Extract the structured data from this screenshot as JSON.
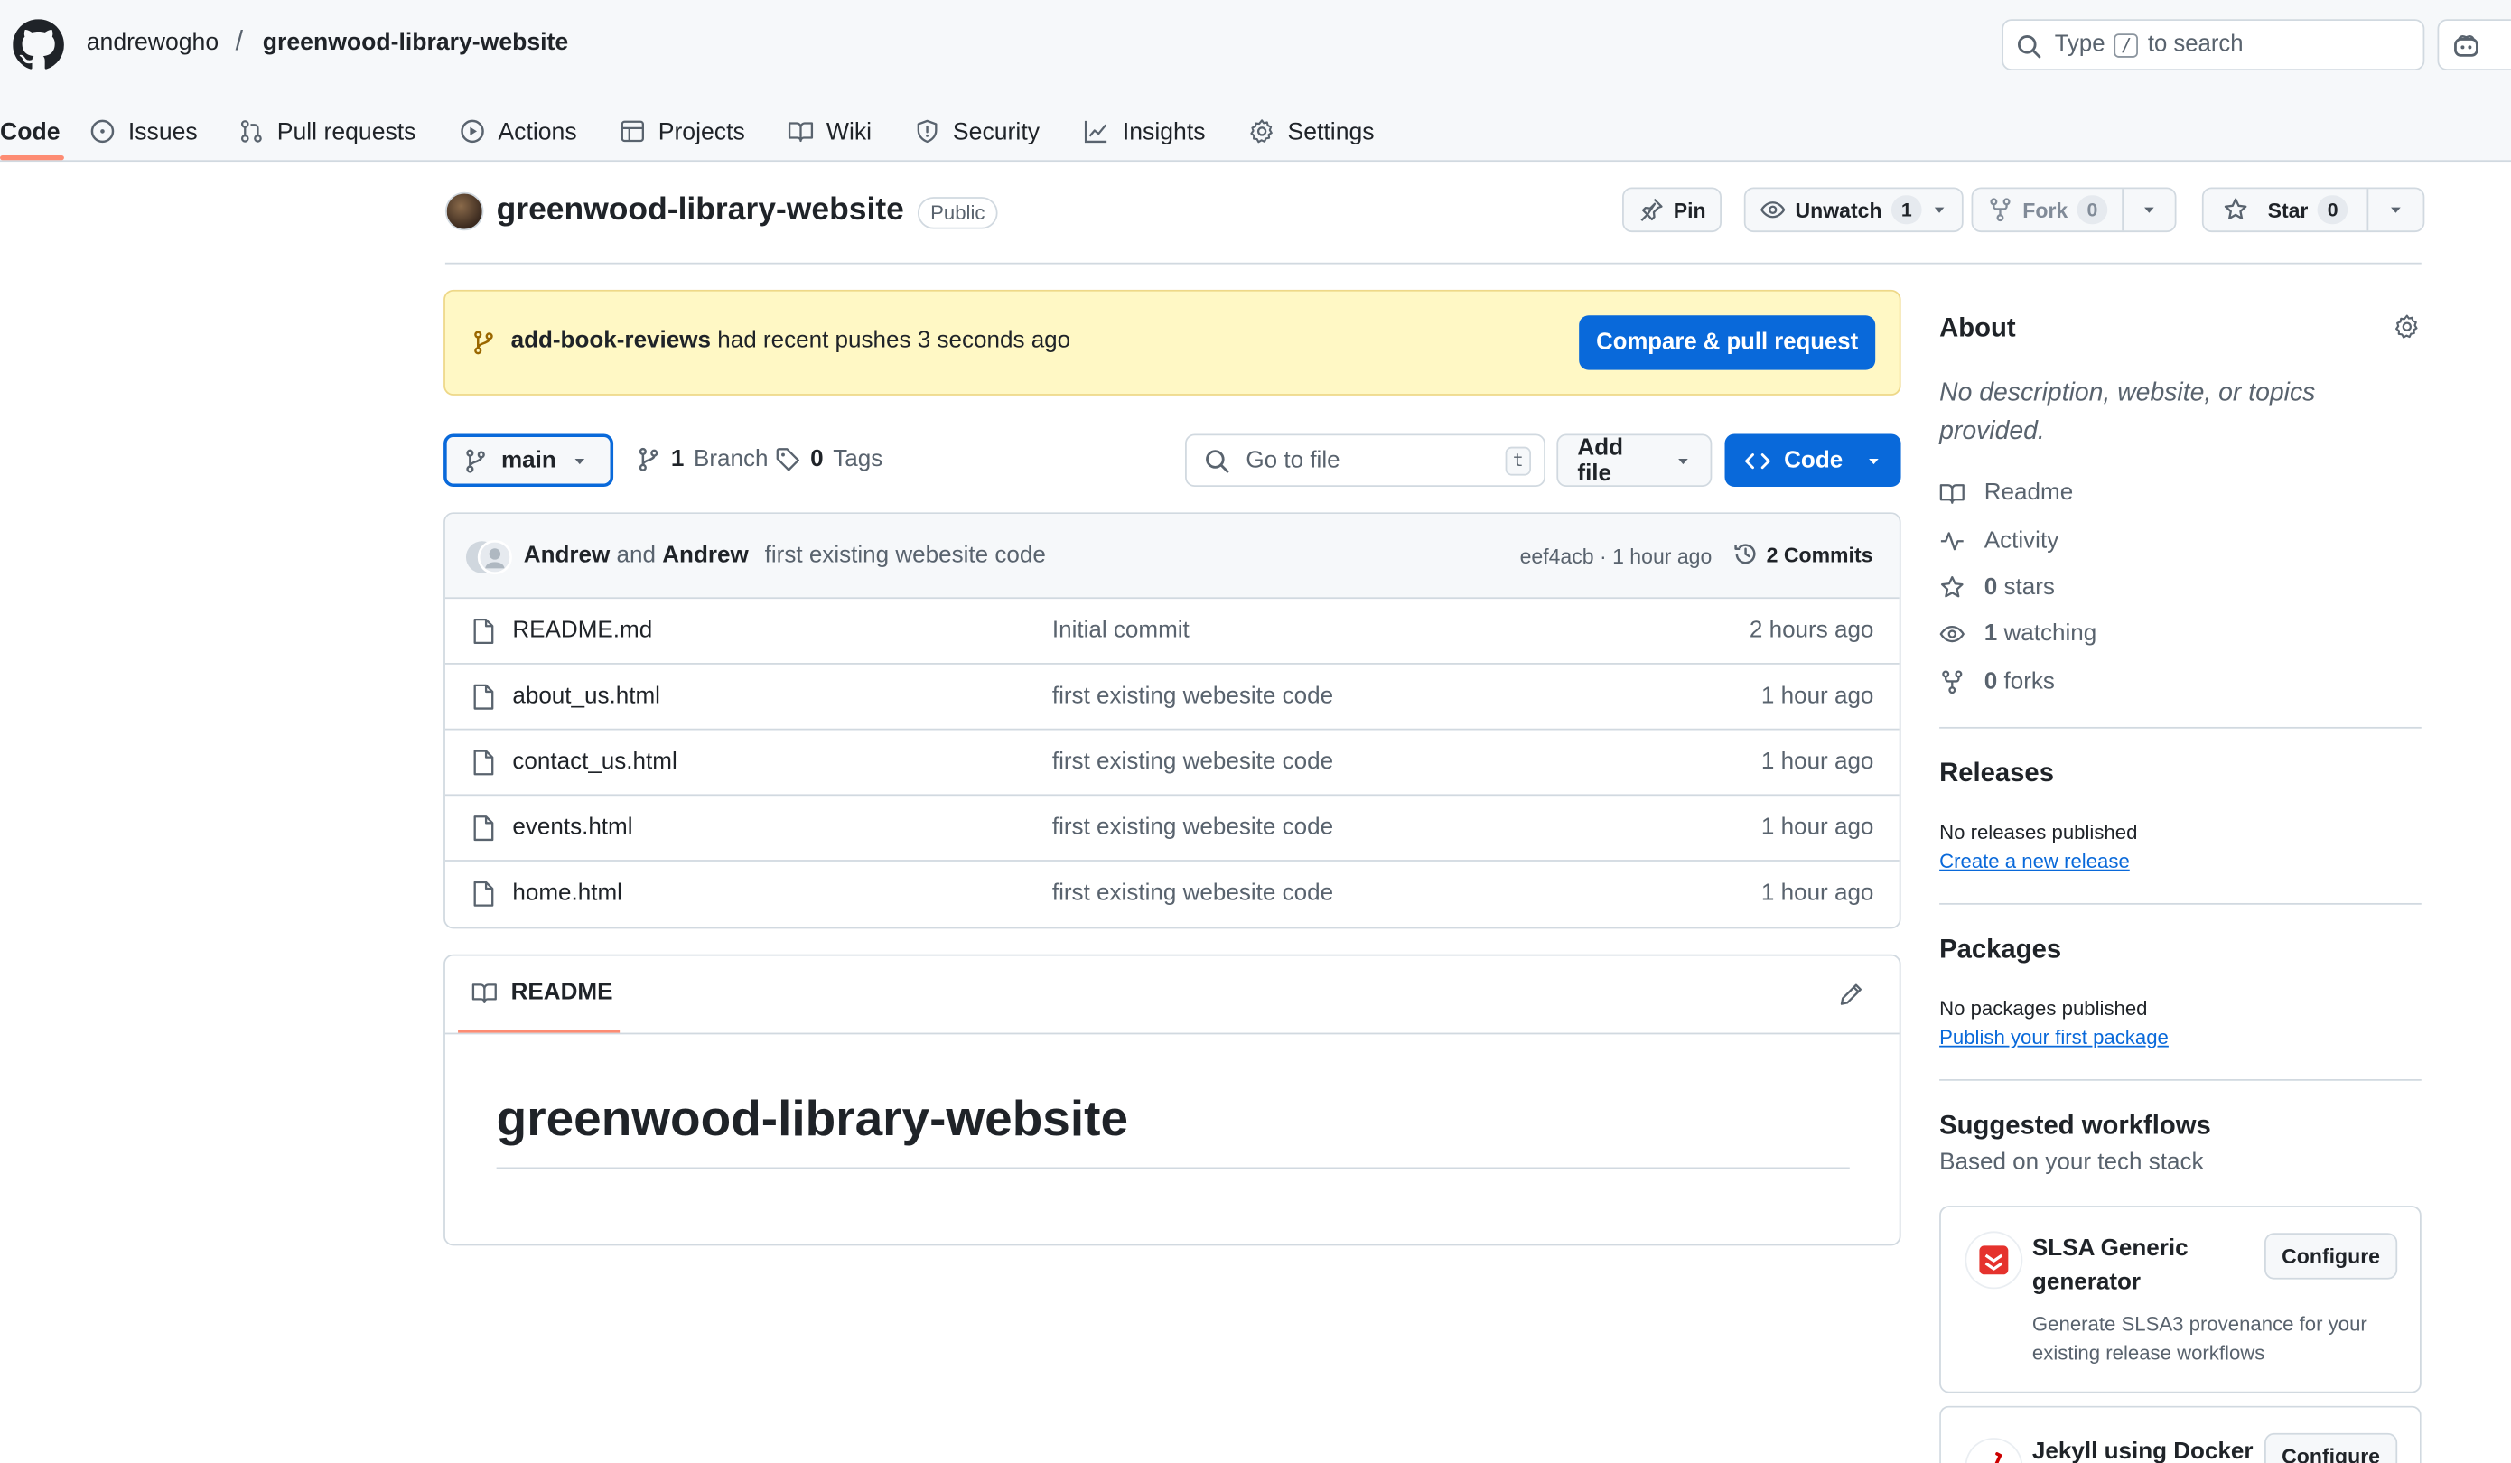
{
  "header": {
    "owner": "andrewogho",
    "separator": "/",
    "repo": "greenwood-library-website",
    "search": {
      "prefix": "Type",
      "key": "/",
      "suffix": "to search"
    }
  },
  "tabs": [
    {
      "label": "Code",
      "icon": "code-icon",
      "active": true
    },
    {
      "label": "Issues",
      "icon": "issue-opened-icon"
    },
    {
      "label": "Pull requests",
      "icon": "git-pull-request-icon"
    },
    {
      "label": "Actions",
      "icon": "play-icon"
    },
    {
      "label": "Projects",
      "icon": "table-icon"
    },
    {
      "label": "Wiki",
      "icon": "book-icon"
    },
    {
      "label": "Security",
      "icon": "shield-icon"
    },
    {
      "label": "Insights",
      "icon": "graph-icon"
    },
    {
      "label": "Settings",
      "icon": "gear-icon"
    }
  ],
  "repo_header": {
    "title": "greenwood-library-website",
    "visibility": "Public",
    "pin_label": "Pin",
    "unwatch_label": "Unwatch",
    "watch_count": "1",
    "fork_label": "Fork",
    "fork_count": "0",
    "star_label": "Star",
    "star_count": "0"
  },
  "banner": {
    "branch": "add-book-reviews",
    "text": "had recent pushes 3 seconds ago",
    "button": "Compare & pull request"
  },
  "file_nav": {
    "branch": "main",
    "branches_count": "1",
    "branches_label": "Branch",
    "tags_count": "0",
    "tags_label": "Tags",
    "goto_placeholder": "Go to file",
    "goto_key": "t",
    "add_file": "Add file",
    "code_button": "Code"
  },
  "commit": {
    "author1": "Andrew",
    "joiner": "and",
    "author2": "Andrew",
    "message": "first existing webesite code",
    "meta": "eef4acb · 1 hour ago",
    "commits_label": "2 Commits"
  },
  "files": [
    {
      "name": "README.md",
      "message": "Initial commit",
      "age": "2 hours ago"
    },
    {
      "name": "about_us.html",
      "message": "first existing webesite code",
      "age": "1 hour ago"
    },
    {
      "name": "contact_us.html",
      "message": "first existing webesite code",
      "age": "1 hour ago"
    },
    {
      "name": "events.html",
      "message": "first existing webesite code",
      "age": "1 hour ago"
    },
    {
      "name": "home.html",
      "message": "first existing webesite code",
      "age": "1 hour ago"
    }
  ],
  "readme": {
    "tab_label": "README",
    "heading": "greenwood-library-website"
  },
  "about": {
    "title": "About",
    "description": "No description, website, or topics provided.",
    "items": [
      {
        "icon": "book-icon",
        "bold": "",
        "label": "Readme"
      },
      {
        "icon": "pulse-icon",
        "bold": "",
        "label": "Activity"
      },
      {
        "icon": "star-icon",
        "bold": "0",
        "label": "stars"
      },
      {
        "icon": "eye-icon",
        "bold": "1",
        "label": "watching"
      },
      {
        "icon": "repo-forked-icon",
        "bold": "0",
        "label": "forks"
      }
    ]
  },
  "releases": {
    "title": "Releases",
    "none_text": "No releases published",
    "link": "Create a new release"
  },
  "packages": {
    "title": "Packages",
    "none_text": "No packages published",
    "link": "Publish your first package"
  },
  "workflows": {
    "title": "Suggested workflows",
    "subtitle": "Based on your tech stack",
    "cards": [
      {
        "title": "SLSA Generic generator",
        "button": "Configure",
        "description": "Generate SLSA3 provenance for your existing release workflows",
        "logo_color": "#e5322d"
      },
      {
        "title": "Jekyll using Docker",
        "button": "Configure",
        "description": "",
        "logo_color": "#cc0000"
      }
    ]
  },
  "colors": {
    "accent": "#0969da",
    "banner_bg": "#fff8c5",
    "tab_underline": "#fd8c73"
  }
}
